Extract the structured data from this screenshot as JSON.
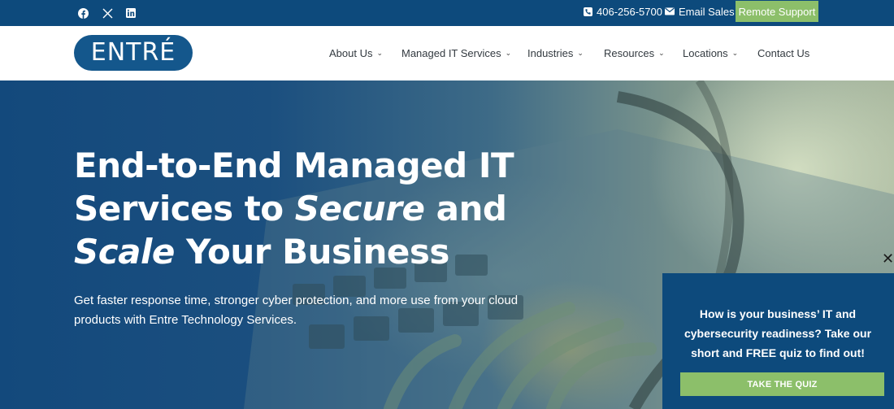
{
  "topbar": {
    "social": [
      {
        "icon": "facebook-icon"
      },
      {
        "icon": "x-twitter-icon"
      },
      {
        "icon": "linkedin-icon"
      }
    ],
    "phone": {
      "icon": "phone-icon",
      "label": "406-256-5700"
    },
    "email": {
      "icon": "mail-icon",
      "label": "Email Sales"
    },
    "remote_support": "Remote Support"
  },
  "header": {
    "logo_text": "ENTRÉ",
    "nav": [
      {
        "label": "About Us",
        "has_dropdown": true
      },
      {
        "label": "Managed IT Services",
        "has_dropdown": true
      },
      {
        "label": "Industries",
        "has_dropdown": true
      },
      {
        "label": "Resources",
        "has_dropdown": true
      },
      {
        "label": "Locations",
        "has_dropdown": true
      },
      {
        "label": "Contact Us",
        "has_dropdown": false
      }
    ],
    "dropdown_glyph": "⌄"
  },
  "hero": {
    "title_line1": "End-to-End Managed IT",
    "title_line2_a": "Services to ",
    "title_line2_em": "Secure",
    "title_line2_b": " and",
    "title_line3_em": "Scale",
    "title_line3_b": " Your Business",
    "subtitle": "Get faster response time, stronger cyber protection, and more use from your cloud products with Entre Technology Services."
  },
  "quiz_popup": {
    "text": "How is your business’ IT and cybersecurity readiness? Take our short and FREE quiz to find out!",
    "button": "TAKE THE QUIZ",
    "close": "✕"
  },
  "colors": {
    "brand_blue": "#0d4a7c",
    "accent_green": "#8cbf6a",
    "nav_text": "#333a40"
  }
}
